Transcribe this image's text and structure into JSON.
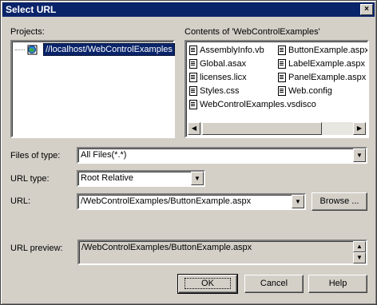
{
  "dialog": {
    "title": "Select URL",
    "close_glyph": "×"
  },
  "projects": {
    "label": "Projects:",
    "items": [
      {
        "label": "//localhost/WebControlExamples",
        "icon": "web-project-icon"
      }
    ]
  },
  "contents": {
    "label": "Contents of 'WebControlExamples'",
    "files": [
      {
        "name": "AssemblyInfo.vb",
        "icon": "file-icon"
      },
      {
        "name": "ButtonExample.aspx",
        "icon": "file-icon"
      },
      {
        "name": "Global.asax",
        "icon": "file-icon"
      },
      {
        "name": "LabelExample.aspx",
        "icon": "file-icon"
      },
      {
        "name": "licenses.licx",
        "icon": "file-icon"
      },
      {
        "name": "PanelExample.aspx",
        "icon": "file-icon"
      },
      {
        "name": "Styles.css",
        "icon": "file-icon"
      },
      {
        "name": "Web.config",
        "icon": "file-icon"
      },
      {
        "name": "WebControlExamples.vsdisco",
        "icon": "file-icon"
      }
    ]
  },
  "files_of_type": {
    "label": "Files of type:",
    "value": "All Files(*.*)"
  },
  "url_type": {
    "label": "URL type:",
    "value": "Root Relative"
  },
  "url": {
    "label": "URL:",
    "value": "/WebControlExamples/ButtonExample.aspx",
    "browse_label": "Browse ..."
  },
  "url_preview": {
    "label": "URL preview:",
    "value": "/WebControlExamples/ButtonExample.aspx"
  },
  "buttons": {
    "ok": "OK",
    "cancel": "Cancel",
    "help": "Help"
  },
  "colors": {
    "titlebar": "#0a246a",
    "face": "#d4d0c8",
    "selection": "#0a246a"
  }
}
